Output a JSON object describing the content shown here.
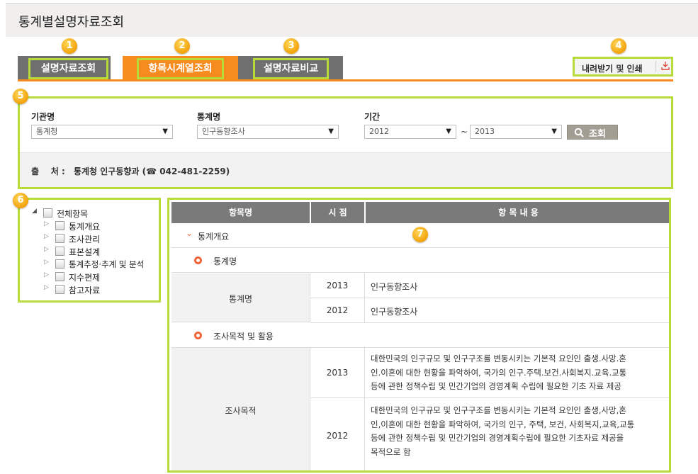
{
  "page_title": "통계별설명자료조회",
  "badges": [
    "1",
    "2",
    "3",
    "4",
    "5",
    "6",
    "7"
  ],
  "tabs": [
    {
      "label": "설명자료조회",
      "active": false
    },
    {
      "label": "항목시계열조회",
      "active": true
    },
    {
      "label": "설명자료비교",
      "active": false
    }
  ],
  "download_label": "내려받기 및 인쇄",
  "filters": {
    "agency": {
      "label": "기관명",
      "value": "통계청"
    },
    "statistic": {
      "label": "통계명",
      "value": "인구동향조사"
    },
    "period": {
      "label": "기간",
      "from": "2012",
      "separator": "~",
      "to": "2013"
    },
    "search_label": "조회"
  },
  "source": {
    "label": "출    처 :",
    "text": "통계청 인구동향과 (☎ 042-481-2259)"
  },
  "tree": {
    "root": "전체항목",
    "items": [
      "통계개요",
      "조사관리",
      "표본설계",
      "통계추정·추계 및 분석",
      "지수편제",
      "참고자료"
    ]
  },
  "table": {
    "headers": [
      "항목명",
      "시 점",
      "항 목 내 용"
    ],
    "section": "통계개요",
    "item1": {
      "title": "통계명",
      "name": "통계명",
      "rows": [
        {
          "year": "2013",
          "content": "인구동향조사"
        },
        {
          "year": "2012",
          "content": "인구동향조사"
        }
      ]
    },
    "item2": {
      "title": "조사목적 및 활용",
      "name": "조사목적",
      "rows": [
        {
          "year": "2013",
          "lines": [
            "대한민국의 인구규모 및 인구구조를 변동시키는 기본적 요인인 출생.사망.혼",
            "인.이혼에 대한 현황을 파악하여, 국가의 인구.주택.보건.사회복지.교육.교통",
            "등에 관한 정책수립 및 민간기업의 경영계획 수립에 필요한 기초 자료 제공"
          ]
        },
        {
          "year": "2012",
          "lines": [
            "대한민국의 인구규모 및 인구구조를 변동시키는 기본적 요인인 출생,사망,혼",
            "인,이혼에 대한 현황을 파악하여, 국가의 인구, 주택, 보건, 사회복지,교육,교통",
            "등에 관한 정책수립 및 민간기업의 경영계획수립에 필요한 기초자료 제공을",
            "목적으로 함"
          ]
        }
      ]
    }
  }
}
